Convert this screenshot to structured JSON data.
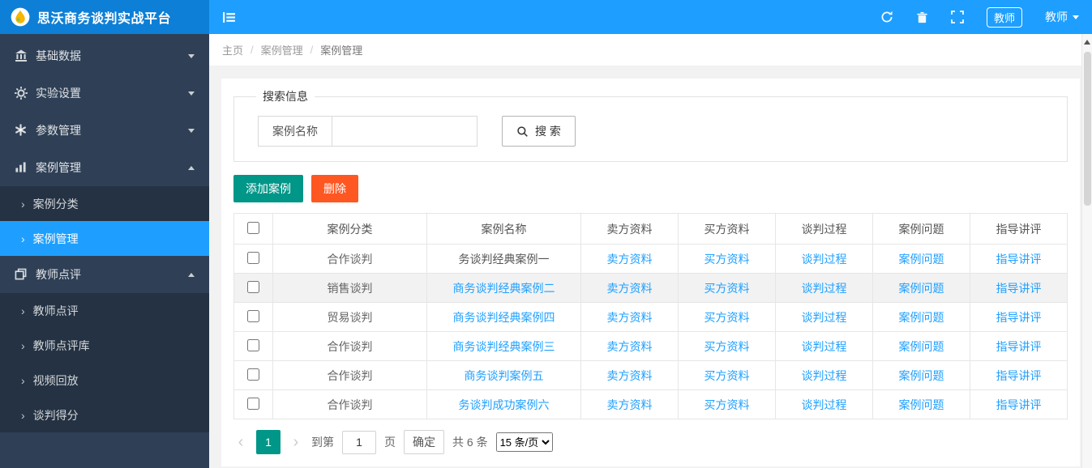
{
  "app": {
    "title": "思沃商务谈判实战平台"
  },
  "colors": {
    "topbar": "#1E9FFF",
    "logo-bg": "#0E7FD6",
    "sidebar-bg": "#2F4056",
    "accent-green": "#009688",
    "accent-orange": "#FF5722",
    "link": "#1E9FFF"
  },
  "topbar": {
    "badge": "教师",
    "user": "教师"
  },
  "sidebar": {
    "groups": [
      {
        "label": "基础数据",
        "expanded": false
      },
      {
        "label": "实验设置",
        "expanded": false
      },
      {
        "label": "参数管理",
        "expanded": false
      },
      {
        "label": "案例管理",
        "expanded": true,
        "children": [
          {
            "label": "案例分类",
            "active": false
          },
          {
            "label": "案例管理",
            "active": true
          }
        ]
      },
      {
        "label": "教师点评",
        "expanded": true,
        "children": [
          {
            "label": "教师点评",
            "active": false
          },
          {
            "label": "教师点评库",
            "active": false
          },
          {
            "label": "视频回放",
            "active": false
          },
          {
            "label": "谈判得分",
            "active": false
          }
        ]
      }
    ],
    "sub_arrow": "›"
  },
  "breadcrumb": {
    "items": [
      "主页",
      "案例管理",
      "案例管理"
    ],
    "separator": "/"
  },
  "search": {
    "legend": "搜索信息",
    "label": "案例名称",
    "value": "",
    "button": "搜 索"
  },
  "toolbar": {
    "add": "添加案例",
    "delete": "删除"
  },
  "table": {
    "headers": [
      "案例分类",
      "案例名称",
      "卖方资料",
      "买方资料",
      "谈判过程",
      "案例问题",
      "指导讲评"
    ],
    "links": [
      "卖方资料",
      "买方资料",
      "谈判过程",
      "案例问题",
      "指导讲评"
    ],
    "rows": [
      {
        "category": "合作谈判",
        "name": "务谈判经典案例一",
        "name_is_link": false,
        "highlighted": false
      },
      {
        "category": "销售谈判",
        "name": "商务谈判经典案例二",
        "name_is_link": true,
        "highlighted": true
      },
      {
        "category": "贸易谈判",
        "name": "商务谈判经典案例四",
        "name_is_link": true,
        "highlighted": false
      },
      {
        "category": "合作谈判",
        "name": "商务谈判经典案例三",
        "name_is_link": true,
        "highlighted": false
      },
      {
        "category": "合作谈判",
        "name": "商务谈判案例五",
        "name_is_link": true,
        "highlighted": false
      },
      {
        "category": "合作谈判",
        "name": "务谈判成功案例六",
        "name_is_link": true,
        "highlighted": false
      }
    ]
  },
  "pagination": {
    "prev": "‹",
    "page": "1",
    "next": "›",
    "goto_label": "到第",
    "goto_value": "1",
    "unit": "页",
    "confirm": "确定",
    "total": "共 6 条",
    "size_option": "15 条/页"
  }
}
